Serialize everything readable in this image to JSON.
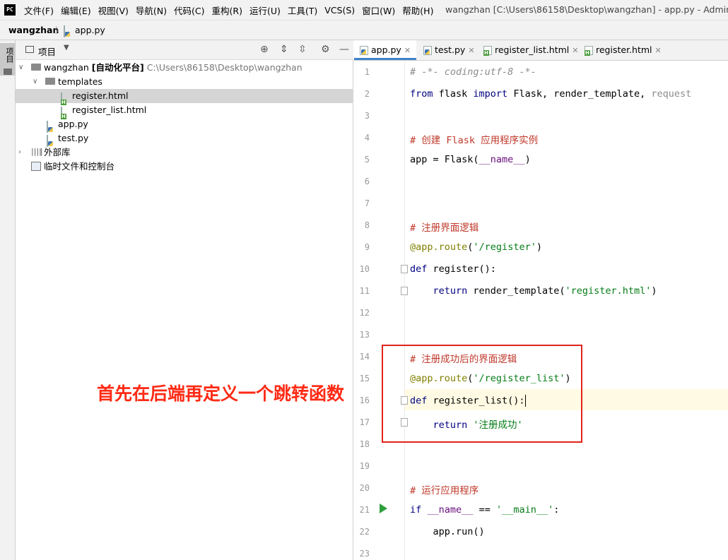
{
  "menubar": {
    "logo": "PC",
    "items": [
      "文件(F)",
      "编辑(E)",
      "视图(V)",
      "导航(N)",
      "代码(C)",
      "重构(R)",
      "运行(U)",
      "工具(T)",
      "VCS(S)",
      "窗口(W)",
      "帮助(H)"
    ],
    "window_title": "wangzhan [C:\\Users\\86158\\Desktop\\wangzhan] - app.py - Administrator"
  },
  "breadcrumb": {
    "project": "wangzhan",
    "file": "app.py"
  },
  "toolstrip": {
    "project_tab": "项目"
  },
  "project_panel": {
    "title": "项目",
    "tree": {
      "root_name": "wangzhan",
      "root_tag": "[自动化平台]",
      "root_path": "C:\\Users\\86158\\Desktop\\wangzhan",
      "templates": "templates",
      "register_html": "register.html",
      "register_list_html": "register_list.html",
      "app_py": "app.py",
      "test_py": "test.py",
      "external_libs": "外部库",
      "scratches": "临时文件和控制台"
    }
  },
  "editor_tabs": [
    "app.py",
    "test.py",
    "register_list.html",
    "register.html"
  ],
  "code": {
    "line_numbers": [
      "1",
      "2",
      "3",
      "4",
      "5",
      "6",
      "7",
      "8",
      "9",
      "10",
      "11",
      "12",
      "13",
      "14",
      "15",
      "16",
      "17",
      "18",
      "19",
      "20",
      "21",
      "22",
      "23"
    ],
    "l1": "# -*- coding:utf-8 -*-",
    "l2_from": "from",
    "l2_mid": " flask ",
    "l2_import": "import",
    "l2_rest": " Flask, render_template, ",
    "l2_unused": "request",
    "l4": "# 创建 Flask 应用程序实例",
    "l5_a": "app = Flask(",
    "l5_b": "__name__",
    "l5_c": ")",
    "l8": "# 注册界面逻辑",
    "l9_dec": "@app.route",
    "l9_p1": "(",
    "l9_str": "'/register'",
    "l9_p2": ")",
    "l10_def": "def",
    "l10_rest": " register():",
    "l11_ret": "    return",
    "l11_rest": " render_template(",
    "l11_str": "'register.html'",
    "l11_end": ")",
    "l14": "# 注册成功后的界面逻辑",
    "l15_dec": "@app.route",
    "l15_p1": "(",
    "l15_str": "'/register_list'",
    "l15_p2": ")",
    "l16_def": "def",
    "l16_rest": " register_list():",
    "l17_ret": "    return",
    "l17_str": " '注册成功'",
    "l20": "# 运行应用程序",
    "l21_if": "if",
    "l21_a": " ",
    "l21_name": "__name__",
    "l21_b": " == ",
    "l21_str": "'__main__'",
    "l21_c": ":",
    "l22": "    app.run()"
  },
  "annotation": {
    "text": "首先在后端再定义一个跳转函数",
    "color": "#ff2a14",
    "box_color": "#e32219"
  },
  "colors": {
    "active_tab_underline": "#4083c9",
    "keyword": "#000080",
    "string": "#067d17",
    "decorator": "#808000",
    "current_line": "#fffae3"
  }
}
